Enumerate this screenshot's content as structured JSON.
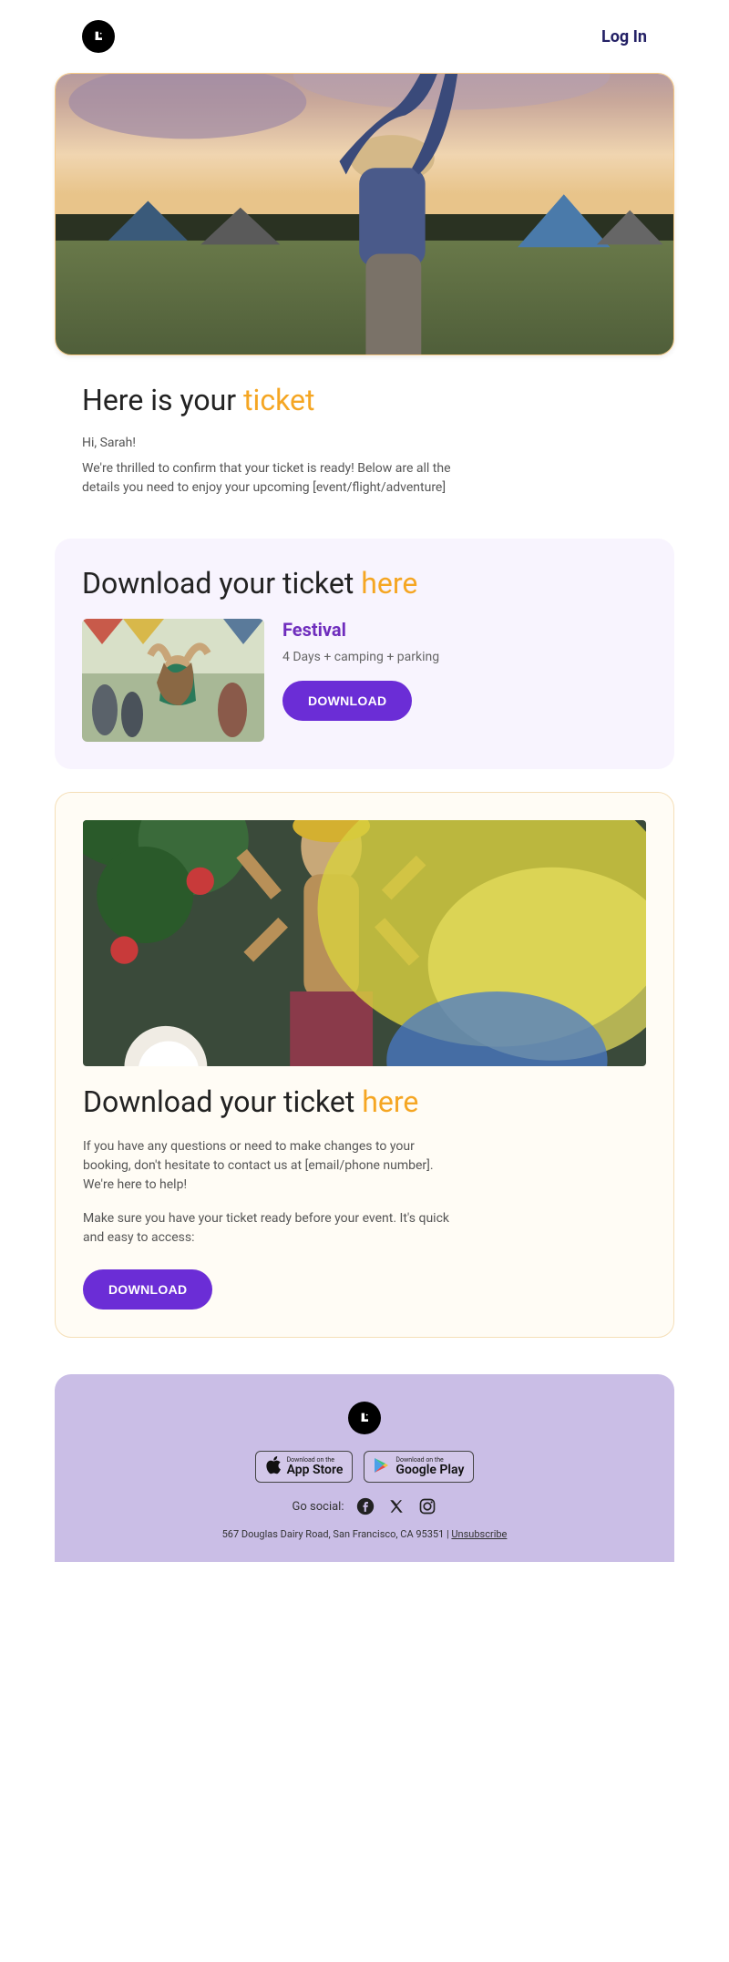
{
  "header": {
    "login": "Log In"
  },
  "intro": {
    "heading_pre": "Here is your ",
    "heading_accent": "ticket",
    "greeting": "Hi, Sarah!",
    "body": "We're thrilled to confirm that your ticket is ready! Below are all the details you need to enjoy your upcoming [event/flight/adventure]"
  },
  "card1": {
    "heading_pre": "Download your ticket ",
    "heading_accent": "here",
    "title": "Festival",
    "subtitle": "4 Days + camping + parking",
    "cta": "DOWNLOAD"
  },
  "card2": {
    "heading_pre": "Download your ticket ",
    "heading_accent": "here",
    "para1": "If you have any questions or need to make changes to your booking, don't hesitate to contact us at [email/phone number]. We're here to help!",
    "para2": "Make sure you have your ticket ready before your event. It's quick and easy to access:",
    "cta": "DOWNLOAD"
  },
  "footer": {
    "appstore_small": "Download on the",
    "appstore_big": "App Store",
    "gplay_small": "Download on the",
    "gplay_big": "Google Play",
    "social_label": "Go social:",
    "address": "567 Douglas Dairy Road, San Francisco, CA 95351 | ",
    "unsubscribe": "Unsubscribe"
  }
}
